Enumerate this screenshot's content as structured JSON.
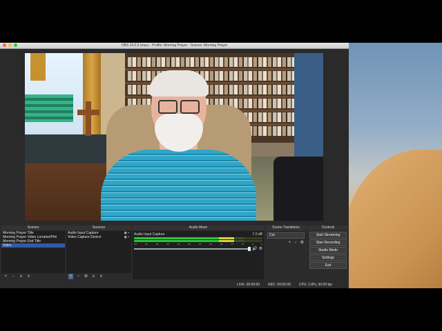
{
  "window": {
    "title": "OBS 24.0.6 (mac) - Profile: Morning Prayer - Scenes: Morning Prayer"
  },
  "docks": {
    "scenes": {
      "title": "Scenes",
      "items": [
        "Morning Prayer Title",
        "Morning Prayer Video Lorraine/Phil",
        "Morning Prayer End Title",
        "Video"
      ],
      "selected": 3
    },
    "sources": {
      "title": "Sources",
      "items": [
        "Audio Input Capture",
        "Video Capture Device"
      ]
    },
    "mixer": {
      "title": "Audio Mixer",
      "channel": {
        "name": "Audio Input Capture",
        "level": "7.0 dB",
        "meter_fraction": 0.78
      },
      "scale": [
        "-60",
        "-55",
        "-50",
        "-45",
        "-40",
        "-35",
        "-30",
        "-25",
        "-20",
        "-15",
        "-10",
        "-5",
        "0"
      ]
    },
    "transitions": {
      "title": "Scene Transitions",
      "selected": "Cut"
    },
    "controls": {
      "title": "Controls",
      "buttons": [
        "Start Streaming",
        "Start Recording",
        "Studio Mode",
        "Settings",
        "Exit"
      ]
    }
  },
  "status": {
    "live": "LIVE: 00:00:00",
    "rec": "REC: 00:00:00",
    "cpu": "CPU: 2.8%, 30.00 fps"
  },
  "icons": {
    "add": "+",
    "remove": "−",
    "up": "∧",
    "down": "∨",
    "gear": "⚙",
    "eye": "👁",
    "lock": "🔒",
    "speaker": "🔊"
  },
  "colors": {
    "accent": "#2f5aa8",
    "panel": "#2b2b2b",
    "meter_green": "#2bc43a"
  }
}
